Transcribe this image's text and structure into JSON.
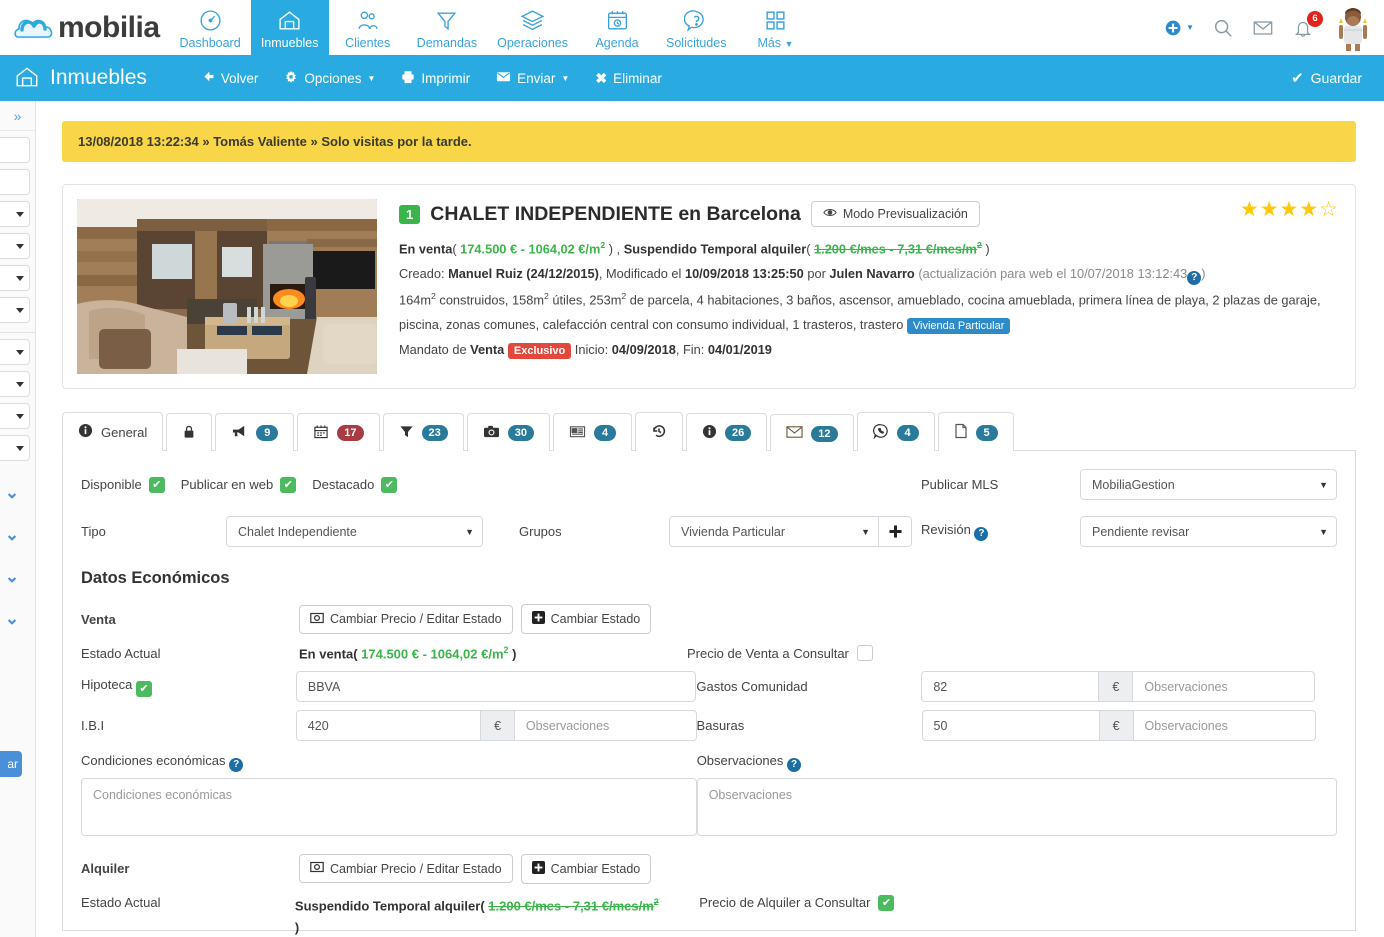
{
  "app": {
    "brand": "mobilia"
  },
  "topnav": {
    "items": [
      {
        "label": "Dashboard",
        "icon": "gauge-icon",
        "active": false
      },
      {
        "label": "Inmuebles",
        "icon": "house-icon",
        "active": true
      },
      {
        "label": "Clientes",
        "icon": "people-icon",
        "active": false
      },
      {
        "label": "Demandas",
        "icon": "funnel-icon",
        "active": false
      },
      {
        "label": "Operaciones",
        "icon": "layers-icon",
        "active": false
      },
      {
        "label": "Agenda",
        "icon": "calendar-clock-icon",
        "active": false
      },
      {
        "label": "Solicitudes",
        "icon": "question-bubble-icon",
        "active": false
      },
      {
        "label": "Más",
        "icon": "grid-icon",
        "active": false,
        "caret": true
      }
    ],
    "actions": {
      "add": "add-circle-icon",
      "search": "search-icon",
      "mail": "envelope-icon",
      "bell": "bell-icon",
      "notification_count": "6",
      "avatar": "user-avatar"
    }
  },
  "subheader": {
    "title": "Inmuebles",
    "tools": [
      {
        "label": "Volver",
        "icon": "arrow-left-icon"
      },
      {
        "label": "Opciones",
        "icon": "gear-icon",
        "caret": true
      },
      {
        "label": "Imprimir",
        "icon": "printer-icon"
      },
      {
        "label": "Enviar",
        "icon": "envelope-icon",
        "caret": true
      },
      {
        "label": "Eliminar",
        "icon": "x-icon"
      }
    ],
    "save_label": "Guardar"
  },
  "alert": {
    "datetime": "13/08/2018 13:22:34",
    "sep1": " » ",
    "user": "Tomás Valiente",
    "sep2": " » ",
    "message": "Solo visitas por la tarde."
  },
  "property": {
    "number_badge": "1",
    "title": "CHALET INDEPENDIENTE en Barcelona",
    "preview_label": "Modo Previsualización",
    "stars_filled": 4,
    "stars_total": 5,
    "status_sale_label": "En venta",
    "status_sale_open": "( ",
    "status_sale_price": "174.500 € - 1064,02 €/m",
    "status_sale_close": " ) ,",
    "status_rent_label": "Suspendido Temporal alquiler",
    "status_rent_open": "( ",
    "status_rent_price": "1.200 €/mes - 7,31 €/mes/m",
    "status_rent_close": " )",
    "created_label": "Creado:",
    "created_by": "Manuel Ruiz (24/12/2015)",
    "modified_label": ", Modificado el",
    "modified_date": "10/09/2018 13:25:50",
    "modified_by_label": "por",
    "modified_by": "Julen Navarro",
    "web_update": "(actualización para web el 10/07/2018 13:12:43",
    "web_update_close": ")",
    "features_line1": "164m2 construidos, 158m2 útiles, 253m2 de parcela, 4 habitaciones, 3 baños, ascensor, amueblado, cocina amueblada, primera línea de playa, 2 plazas de garaje,",
    "features_part_a": "164m",
    "features_part_b": " construidos, 158m",
    "features_part_c": " útiles, 253m",
    "features_part_d": " de parcela, 4 habitaciones, 3 baños, ascensor, amueblado, cocina amueblada, primera línea de playa, 2 plazas de garaje,",
    "features_line2": "piscina, zonas comunes, calefacción central con consumo individual, 1 trasteros, trastero",
    "group_tag": "Vivienda Particular",
    "mandate_label": "Mandato de",
    "mandate_type": "Venta",
    "mandate_badge": "Exclusivo",
    "mandate_start_label": "Inicio:",
    "mandate_start": "04/09/2018",
    "mandate_end_label": ", Fin:",
    "mandate_end": "04/01/2019"
  },
  "tabs": [
    {
      "id": "general",
      "label": "General",
      "icon": "info-icon",
      "count": null,
      "active": true
    },
    {
      "id": "lock",
      "label": "",
      "icon": "lock-icon",
      "count": null,
      "active": false
    },
    {
      "id": "megaphone",
      "label": "",
      "icon": "megaphone-icon",
      "count": "9",
      "badge_color": "blue",
      "active": false
    },
    {
      "id": "calendar",
      "label": "",
      "icon": "calendar-icon",
      "count": "17",
      "badge_color": "red",
      "active": false
    },
    {
      "id": "funnel",
      "label": "",
      "icon": "funnel-icon",
      "count": "23",
      "badge_color": "blue",
      "active": false
    },
    {
      "id": "photos",
      "label": "",
      "icon": "camera-icon",
      "count": "30",
      "badge_color": "blue",
      "active": false
    },
    {
      "id": "portals",
      "label": "",
      "icon": "newspaper-icon",
      "count": "4",
      "badge_color": "blue",
      "active": false
    },
    {
      "id": "history",
      "label": "",
      "icon": "history-icon",
      "count": null,
      "active": false
    },
    {
      "id": "info",
      "label": "",
      "icon": "info-circle-icon",
      "count": "26",
      "badge_color": "blue",
      "active": false
    },
    {
      "id": "mail",
      "label": "",
      "icon": "envelope-icon",
      "count": "12",
      "badge_color": "blue",
      "active": false
    },
    {
      "id": "whatsapp",
      "label": "",
      "icon": "whatsapp-icon",
      "count": "4",
      "badge_color": "blue",
      "active": false
    },
    {
      "id": "docs",
      "label": "",
      "icon": "document-icon",
      "count": "5",
      "badge_color": "blue",
      "active": false
    }
  ],
  "form": {
    "disponible_label": "Disponible",
    "disponible_checked": true,
    "publicar_web_label": "Publicar en web",
    "publicar_web_checked": true,
    "destacado_label": "Destacado",
    "destacado_checked": true,
    "tipo_label": "Tipo",
    "tipo_value": "Chalet Independiente",
    "grupos_label": "Grupos",
    "grupos_value": "Vivienda Particular",
    "add_group_icon": "plus-icon",
    "publicar_mls_label": "Publicar MLS",
    "publicar_mls_value": "MobiliaGestion",
    "revision_label": "Revisión",
    "revision_value": "Pendiente revisar"
  },
  "economics": {
    "section_title": "Datos Económicos",
    "venta_label": "Venta",
    "btn_cambiar_precio": "Cambiar Precio / Editar Estado",
    "btn_cambiar_estado": "Cambiar Estado",
    "estado_actual_label": "Estado Actual",
    "venta_estado_prefix": "En venta",
    "venta_estado_open": "( ",
    "venta_estado_price": "174.500 € - 1064,02 €/m",
    "venta_estado_close": " )",
    "hipoteca_label": "Hipoteca",
    "hipoteca_checked": true,
    "hipoteca_value": "BBVA",
    "ibi_label": "I.B.I",
    "ibi_value": "420",
    "ibi_unit": "€",
    "ibi_obs_placeholder": "Observaciones",
    "precio_venta_consultar_label": "Precio de Venta a Consultar",
    "precio_venta_consultar_checked": false,
    "gastos_comunidad_label": "Gastos Comunidad",
    "gastos_comunidad_value": "82",
    "gastos_comunidad_unit": "€",
    "gastos_comunidad_obs_placeholder": "Observaciones",
    "basuras_label": "Basuras",
    "basuras_value": "50",
    "basuras_unit": "€",
    "basuras_obs_placeholder": "Observaciones",
    "condiciones_label": "Condiciones económicas",
    "condiciones_placeholder": "Condiciones económicas",
    "observaciones_label": "Observaciones",
    "observaciones_placeholder": "Observaciones",
    "alquiler_label": "Alquiler",
    "alquiler_estado_prefix": "Suspendido Temporal alquiler",
    "alquiler_estado_open": "( ",
    "alquiler_estado_price": "1.200 €/mes - 7,31 €/mes/m",
    "alquiler_estado_close": ")",
    "precio_alquiler_consultar_label": "Precio de Alquiler a Consultar",
    "precio_alquiler_consultar_checked": true
  },
  "colors": {
    "brand_blue": "#29abe2",
    "green": "#3ab54a",
    "alert_yellow": "#f8d648",
    "badge_blue": "#2a7a9b",
    "badge_red": "#a93b42",
    "star_gold": "#ffc907"
  }
}
